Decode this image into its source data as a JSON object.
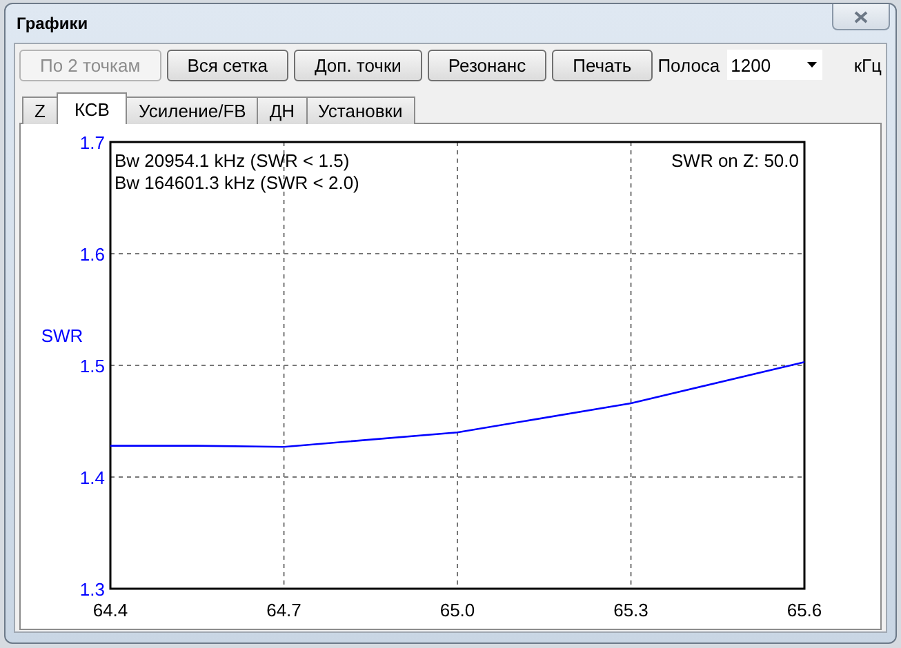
{
  "window": {
    "title": "Графики"
  },
  "toolbar": {
    "buttons": [
      {
        "label": "По 2 точкам",
        "disabled": true
      },
      {
        "label": "Вся сетка",
        "disabled": false
      },
      {
        "label": "Доп. точки",
        "disabled": false
      },
      {
        "label": "Резонанс",
        "disabled": false
      },
      {
        "label": "Печать",
        "disabled": false
      }
    ],
    "band_label": "Полоса",
    "band_select": {
      "value": "1200"
    },
    "units": "кГц"
  },
  "tabs": [
    {
      "label": "Z",
      "selected": false
    },
    {
      "label": "КСВ",
      "selected": true
    },
    {
      "label": "Усиление/FB",
      "selected": false
    },
    {
      "label": "ДН",
      "selected": false
    },
    {
      "label": "Установки",
      "selected": false
    }
  ],
  "chart": {
    "info_lines": [
      "Bw 20954.1 kHz (SWR < 1.5)",
      "Bw 164601.3 kHz (SWR < 2.0)"
    ],
    "impedance_note": "SWR on Z: 50.0",
    "chart_data": {
      "type": "line",
      "ylabel": "SWR",
      "x": [
        64.4,
        64.55,
        64.7,
        65.0,
        65.3,
        65.6
      ],
      "grid": true,
      "series": [
        {
          "color": "#0000ff",
          "values": [
            1.428,
            1.428,
            1.427,
            1.44,
            1.466,
            1.503
          ]
        }
      ],
      "xlim": [
        64.4,
        65.6
      ],
      "ylim": [
        1.3,
        1.7
      ],
      "xticks": [
        {
          "value": 64.4,
          "label": "64.4"
        },
        {
          "value": 64.7,
          "label": "64.7"
        },
        {
          "value": 65.0,
          "label": "65.0"
        },
        {
          "value": 65.3,
          "label": "65.3"
        },
        {
          "value": 65.6,
          "label": "65.6"
        }
      ],
      "yticks": [
        {
          "value": 1.3,
          "label": "1.3"
        },
        {
          "value": 1.4,
          "label": "1.4"
        },
        {
          "value": 1.5,
          "label": "1.5"
        },
        {
          "value": 1.6,
          "label": "1.6"
        },
        {
          "value": 1.7,
          "label": "1.7"
        }
      ]
    }
  }
}
